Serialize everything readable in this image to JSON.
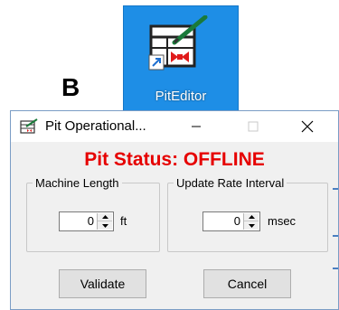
{
  "figure": {
    "label": "B"
  },
  "desktop_icon": {
    "caption": "PitEditor",
    "background": "#1e8ee6"
  },
  "dialog": {
    "title": "Pit Operational...",
    "status": "Pit Status: OFFLINE",
    "status_color": "#e60000",
    "machine_length": {
      "legend": "Machine Length",
      "value": "0",
      "unit": "ft"
    },
    "update_rate": {
      "legend": "Update Rate Interval",
      "value": "0",
      "unit": "msec"
    },
    "buttons": {
      "validate": "Validate",
      "cancel": "Cancel"
    },
    "window_controls": {
      "minimize": "minimize-icon",
      "maximize": "maximize-icon",
      "close": "close-icon"
    }
  }
}
